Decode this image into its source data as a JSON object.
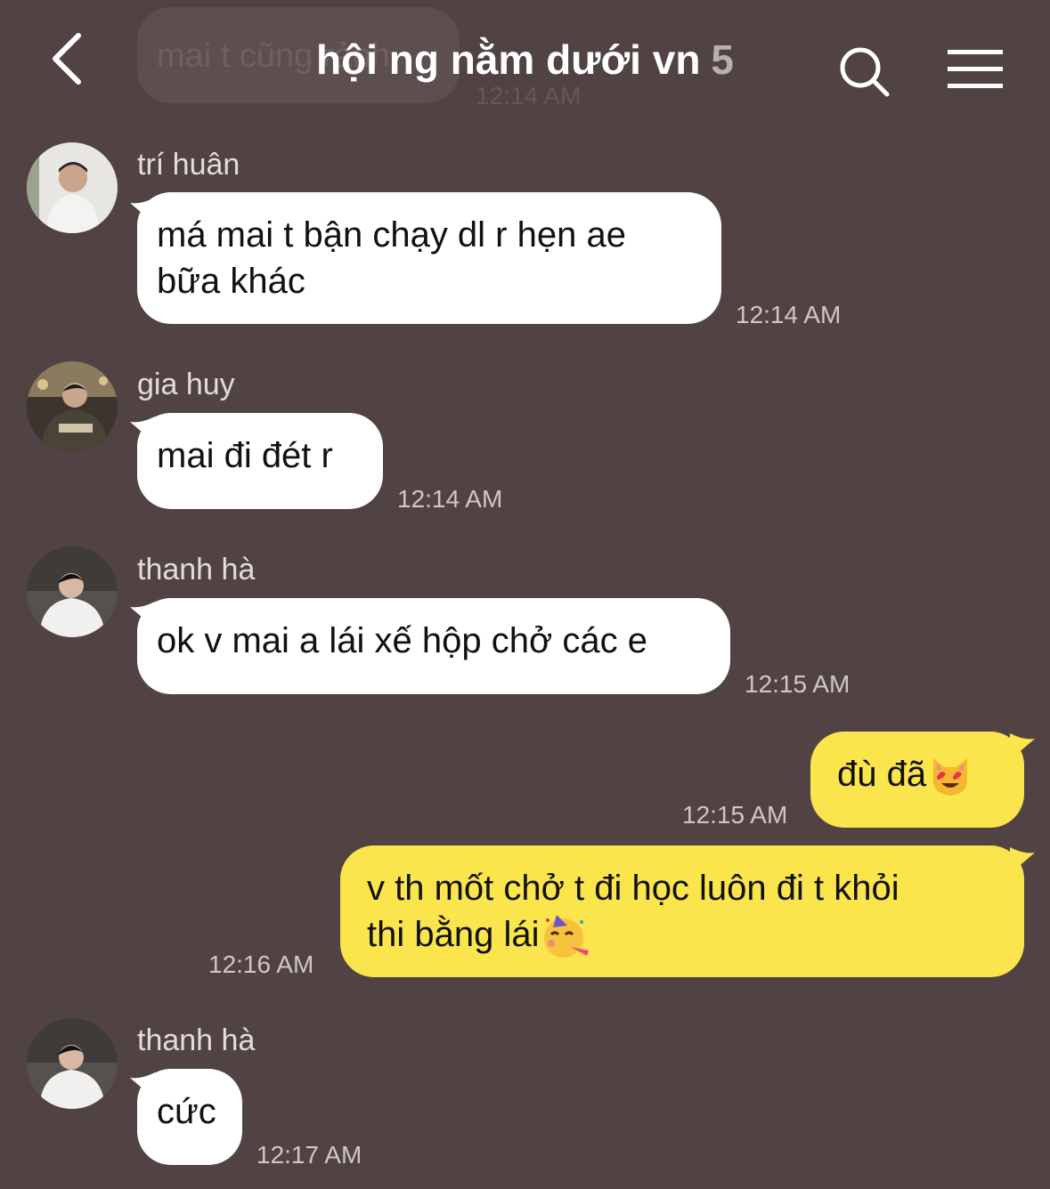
{
  "header": {
    "title": "hội ng nằm dưới vn",
    "member_count": "5",
    "back_icon": "chevron-left-icon",
    "search_icon": "search-icon",
    "menu_icon": "hamburger-menu-icon"
  },
  "partial_message": {
    "text": "mai t cũng rảnh",
    "time": "12:14 AM"
  },
  "messages": [
    {
      "sender": "trí huân",
      "line1": "má mai t bận chạy dl r hẹn ae",
      "line2": "bữa khác",
      "time": "12:14 AM"
    },
    {
      "sender": "gia huy",
      "text": "mai đi đét r",
      "time": "12:14 AM"
    },
    {
      "sender": "thanh hà",
      "text": "ok v mai a lái xế hộp chở các e",
      "time": "12:15 AM"
    },
    {
      "text": "đù đã",
      "emoji": "heart-eyes-cat-emoji",
      "time": "12:15 AM"
    },
    {
      "line1": "v th mốt chở t đi học luôn đi t khỏi",
      "line2": "thi bằng lái",
      "emoji": "partying-face-emoji",
      "time": "12:16 AM"
    },
    {
      "sender": "thanh hà",
      "text": "cức",
      "time": "12:17 AM"
    }
  ],
  "colors": {
    "background": "#514343",
    "incoming_bubble": "#ffffff",
    "outgoing_bubble": "#fbe54d",
    "timestamp": "#cfc7c5"
  }
}
